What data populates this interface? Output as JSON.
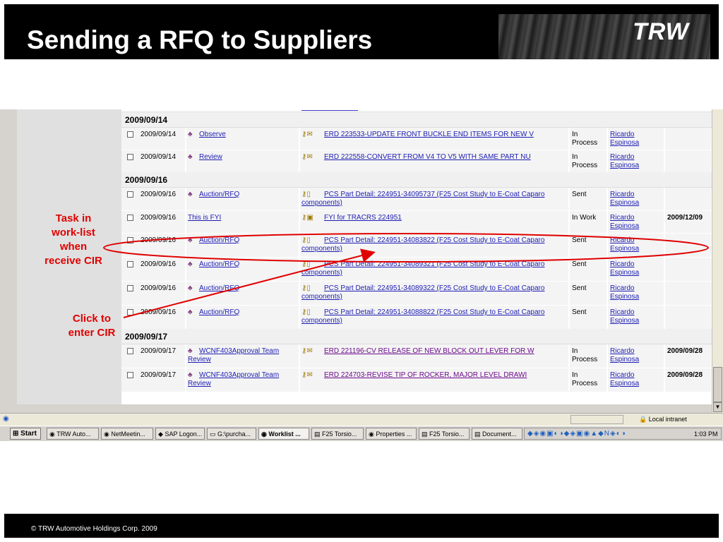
{
  "slide": {
    "title": "Sending a RFQ to Suppliers",
    "logo_text": "TRW",
    "footer": "© TRW Automotive Holdings Corp. 2009"
  },
  "worklist": {
    "groups": [
      {
        "date": "2009/09/14",
        "rows": [
          {
            "date": "2009/09/14",
            "action": "Observe",
            "subject": "ERD 223533-UPDATE FRONT BUCKLE END ITEMS FOR NEW V",
            "status_line1": "In",
            "status_line2": "Process",
            "person_line1": "Ricardo",
            "person_line2": "Espinosa",
            "due": ""
          },
          {
            "date": "2009/09/14",
            "action": "Review",
            "subject": "ERD 222558-CONVERT FROM V4 TO V5 WITH SAME PART NU",
            "status_line1": "In",
            "status_line2": "Process",
            "person_line1": "Ricardo",
            "person_line2": "Espinosa",
            "due": ""
          }
        ]
      },
      {
        "date": "2009/09/16",
        "rows": [
          {
            "date": "2009/09/16",
            "action": "Auction/RFQ",
            "subject_line1": "PCS Part Detail: 224951-34095737 (F25 Cost Study to E-Coat Caparo",
            "subject_line2": "components)",
            "status_line1": "Sent",
            "person_line1": "Ricardo",
            "person_line2": "Espinosa",
            "due": ""
          },
          {
            "date": "2009/09/16",
            "action": "This is FYI",
            "subject": "FYI for TRACRS 224951",
            "status_line1": "In Work",
            "person_line1": "Ricardo",
            "person_line2": "Espinosa",
            "due": "2009/12/09"
          },
          {
            "date": "2009/09/16",
            "action": "Auction/RFQ",
            "subject_line1": "PCS Part Detail: 224951-34083822 (F25 Cost Study to E-Coat Caparo",
            "subject_line2": "components)",
            "status_line1": "Sent",
            "person_line1": "Ricardo",
            "person_line2": "Espinosa",
            "due": ""
          },
          {
            "date": "2009/09/16",
            "action": "Auction/RFQ",
            "subject_line1": "PCS Part Detail: 224951-34089321 (F25 Cost Study to E-Coat Caparo",
            "subject_line2": "components)",
            "status_line1": "Sent",
            "person_line1": "Ricardo",
            "person_line2": "Espinosa",
            "due": ""
          },
          {
            "date": "2009/09/16",
            "action": "Auction/RFQ",
            "subject_line1": "PCS Part Detail: 224951-34089322 (F25 Cost Study to E-Coat Caparo",
            "subject_line2": "components)",
            "status_line1": "Sent",
            "person_line1": "Ricardo",
            "person_line2": "Espinosa",
            "due": ""
          },
          {
            "date": "2009/09/16",
            "action": "Auction/RFQ",
            "subject_line1": "PCS Part Detail: 224951-34088822 (F25 Cost Study to E-Coat Caparo",
            "subject_line2": "components)",
            "status_line1": "Sent",
            "person_line1": "Ricardo",
            "person_line2": "Espinosa",
            "due": ""
          }
        ]
      },
      {
        "date": "2009/09/17",
        "rows": [
          {
            "date": "2009/09/17",
            "action_line1": "WCNF403Approval Team",
            "action_line2": "Review",
            "subject": "ERD 221196-CV RELEASE OF NEW BLOCK OUT LEVER FOR W",
            "status_line1": "In",
            "status_line2": "Process",
            "person_line1": "Ricardo",
            "person_line2": "Espinosa",
            "due": "2009/09/28"
          },
          {
            "date": "2009/09/17",
            "action_line1": "WCNF403Approval Team",
            "action_line2": "Review",
            "subject": "ERD 224703-REVISE TIP OF ROCKER, MAJOR LEVEL DRAWI",
            "status_line1": "In",
            "status_line2": "Process",
            "person_line1": "Ricardo",
            "person_line2": "Espinosa",
            "due": "2009/09/28"
          }
        ]
      }
    ]
  },
  "browser_status": {
    "zone": "Local intranet"
  },
  "taskbar": {
    "start": "Start",
    "buttons": [
      "TRW Auto...",
      "NetMeetin...",
      "SAP Logon...",
      "G:\\purcha...",
      "Worklist ...",
      "F25 Torsio...",
      "Properties ...",
      "F25 Torsio...",
      "Document..."
    ],
    "clock": "1:03 PM"
  },
  "annotations": {
    "task_line1": "Task in",
    "task_line2": "work-list",
    "task_line3": "when",
    "task_line4": "receive CIR",
    "click_line1": "Click to",
    "click_line2": "enter CIR",
    "color": "#e00000"
  }
}
